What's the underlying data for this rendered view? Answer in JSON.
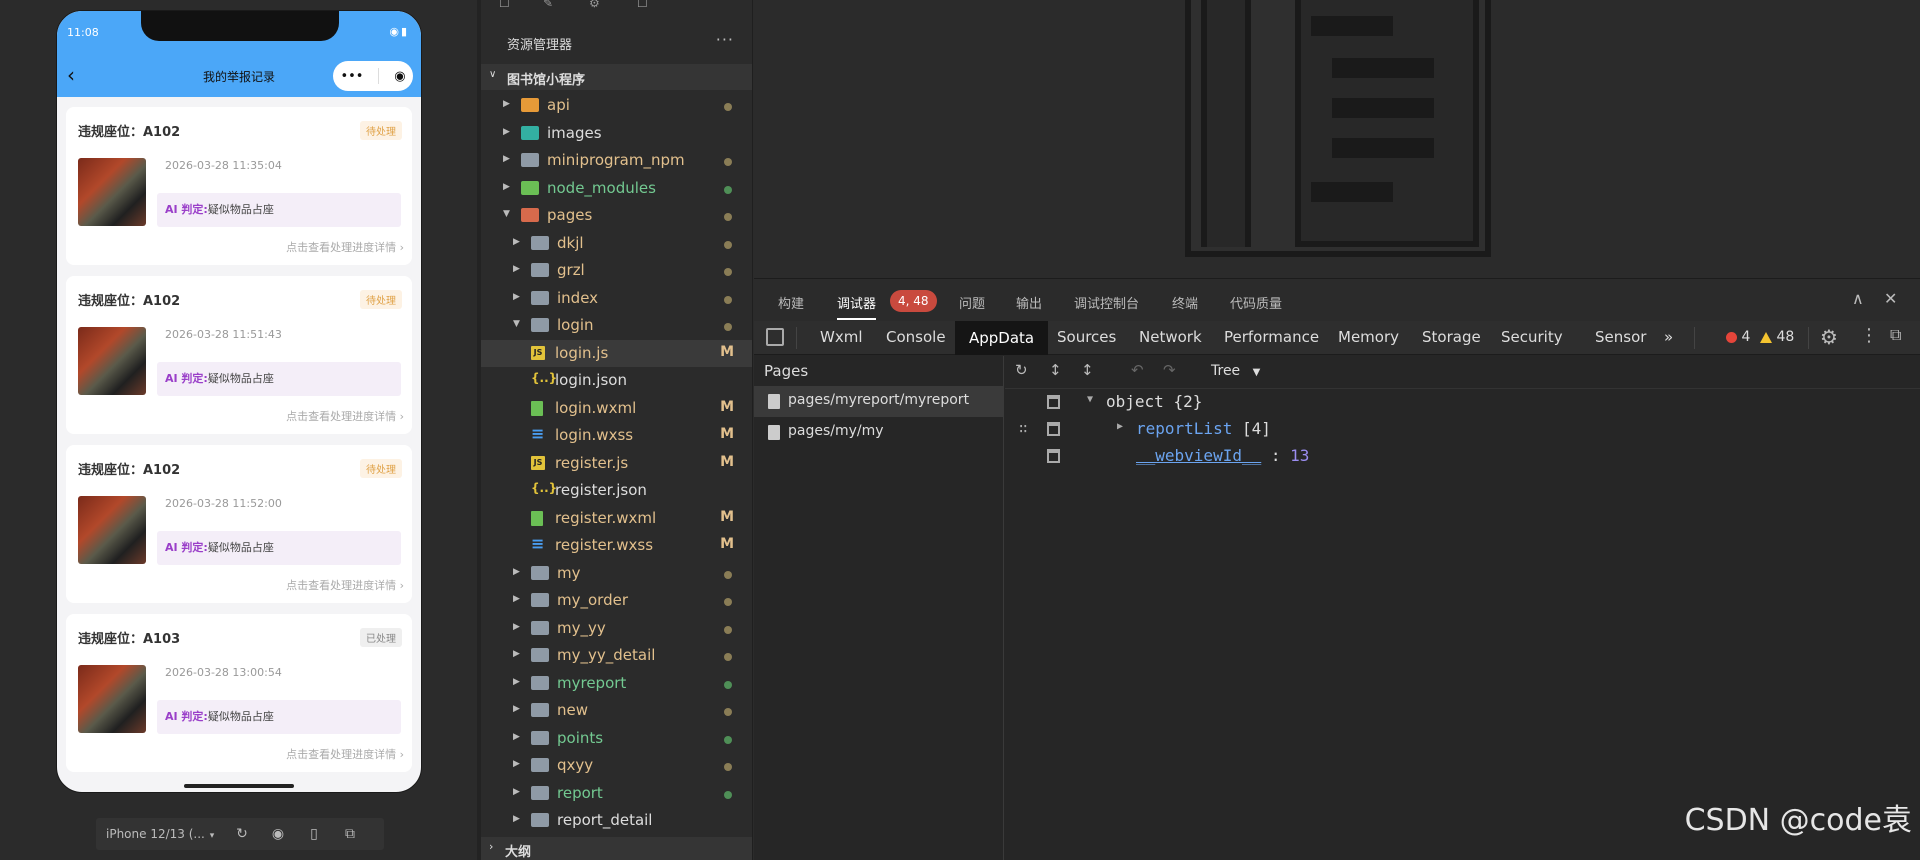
{
  "simulator": {
    "status_time": "11:08",
    "nav_title": "我的举报记录",
    "nav_back_icon": "chevron-left-icon",
    "capsule_more": "•••",
    "capsule_close": "◉",
    "cards": [
      {
        "title": "违规座位：A102",
        "status": "待处理",
        "status_type": "pending",
        "time": "2026-03-28 11:35:04",
        "ai_label": "AI 判定:",
        "ai_text": "疑似物品占座",
        "link": "点击查看处理进度详情 ›"
      },
      {
        "title": "违规座位：A102",
        "status": "待处理",
        "status_type": "pending",
        "time": "2026-03-28 11:51:43",
        "ai_label": "AI 判定:",
        "ai_text": "疑似物品占座",
        "link": "点击查看处理进度详情 ›"
      },
      {
        "title": "违规座位：A102",
        "status": "待处理",
        "status_type": "pending",
        "time": "2026-03-28 11:52:00",
        "ai_label": "AI 判定:",
        "ai_text": "疑似物品占座",
        "link": "点击查看处理进度详情 ›"
      },
      {
        "title": "违规座位：A103",
        "status": "已处理",
        "status_type": "done",
        "time": "2026-03-28 13:00:54",
        "ai_label": "AI 判定:",
        "ai_text": "疑似物品占座",
        "link": "点击查看处理进度详情 ›"
      }
    ],
    "device": "iPhone 12/13 (...",
    "colors": {
      "nav": "#4ba7f8",
      "pending": "#e0a247",
      "ai_label": "#9a3fc9"
    }
  },
  "explorer": {
    "title": "资源管理器",
    "more": "···",
    "project": "图书馆小程序",
    "outline": "大纲",
    "items": [
      {
        "name": "api",
        "depth": 0,
        "type": "folder",
        "color": "orange",
        "expanded": false,
        "status": "dot",
        "name_color": "#e2c08d"
      },
      {
        "name": "images",
        "depth": 0,
        "type": "folder",
        "color": "teal",
        "expanded": false,
        "status": "none",
        "name_color": "#dddddd"
      },
      {
        "name": "miniprogram_npm",
        "depth": 0,
        "type": "folder",
        "color": "gray",
        "expanded": false,
        "status": "dot",
        "name_color": "#e2c08d"
      },
      {
        "name": "node_modules",
        "depth": 0,
        "type": "folder",
        "color": "green",
        "expanded": false,
        "status": "dot-green",
        "name_color": "#73c991"
      },
      {
        "name": "pages",
        "depth": 0,
        "type": "folder",
        "color": "red",
        "expanded": true,
        "status": "dot",
        "name_color": "#e2c08d"
      },
      {
        "name": "dkjl",
        "depth": 1,
        "type": "folder",
        "color": "gray",
        "expanded": false,
        "status": "dot",
        "name_color": "#e2c08d"
      },
      {
        "name": "grzl",
        "depth": 1,
        "type": "folder",
        "color": "gray",
        "expanded": false,
        "status": "dot",
        "name_color": "#e2c08d"
      },
      {
        "name": "index",
        "depth": 1,
        "type": "folder",
        "color": "gray",
        "expanded": false,
        "status": "dot",
        "name_color": "#e2c08d"
      },
      {
        "name": "login",
        "depth": 1,
        "type": "folder",
        "color": "open",
        "expanded": true,
        "status": "dot",
        "name_color": "#e2c08d"
      },
      {
        "name": "login.js",
        "depth": 2,
        "type": "js",
        "status": "M",
        "name_color": "#e2c08d",
        "selected": true
      },
      {
        "name": "login.json",
        "depth": 2,
        "type": "json",
        "status": "none",
        "name_color": "#dddddd"
      },
      {
        "name": "login.wxml",
        "depth": 2,
        "type": "wxml",
        "status": "M",
        "name_color": "#e2c08d"
      },
      {
        "name": "login.wxss",
        "depth": 2,
        "type": "wxss",
        "status": "M",
        "name_color": "#e2c08d"
      },
      {
        "name": "register.js",
        "depth": 2,
        "type": "js",
        "status": "M",
        "name_color": "#e2c08d"
      },
      {
        "name": "register.json",
        "depth": 2,
        "type": "json",
        "status": "none",
        "name_color": "#dddddd"
      },
      {
        "name": "register.wxml",
        "depth": 2,
        "type": "wxml",
        "status": "M",
        "name_color": "#e2c08d"
      },
      {
        "name": "register.wxss",
        "depth": 2,
        "type": "wxss",
        "status": "M",
        "name_color": "#e2c08d"
      },
      {
        "name": "my",
        "depth": 1,
        "type": "folder",
        "color": "gray",
        "expanded": false,
        "status": "dot",
        "name_color": "#e2c08d"
      },
      {
        "name": "my_order",
        "depth": 1,
        "type": "folder",
        "color": "gray",
        "expanded": false,
        "status": "dot",
        "name_color": "#e2c08d"
      },
      {
        "name": "my_yy",
        "depth": 1,
        "type": "folder",
        "color": "gray",
        "expanded": false,
        "status": "dot",
        "name_color": "#e2c08d"
      },
      {
        "name": "my_yy_detail",
        "depth": 1,
        "type": "folder",
        "color": "gray",
        "expanded": false,
        "status": "dot",
        "name_color": "#e2c08d"
      },
      {
        "name": "myreport",
        "depth": 1,
        "type": "folder",
        "color": "gray",
        "expanded": false,
        "status": "dot-green",
        "name_color": "#73c991"
      },
      {
        "name": "new",
        "depth": 1,
        "type": "folder",
        "color": "gray",
        "expanded": false,
        "status": "dot",
        "name_color": "#e2c08d"
      },
      {
        "name": "points",
        "depth": 1,
        "type": "folder",
        "color": "gray",
        "expanded": false,
        "status": "dot-green",
        "name_color": "#73c991"
      },
      {
        "name": "qxyy",
        "depth": 1,
        "type": "folder",
        "color": "gray",
        "expanded": false,
        "status": "dot",
        "name_color": "#e2c08d"
      },
      {
        "name": "report",
        "depth": 1,
        "type": "folder",
        "color": "gray",
        "expanded": false,
        "status": "dot-green",
        "name_color": "#73c991"
      },
      {
        "name": "report_detail",
        "depth": 1,
        "type": "folder",
        "color": "gray",
        "expanded": false,
        "status": "none",
        "name_color": "#dddddd"
      }
    ]
  },
  "debugger": {
    "top_tabs": [
      "构建",
      "调试器",
      "问题",
      "输出",
      "调试控制台",
      "终端",
      "代码质量"
    ],
    "active_top_tab": "调试器",
    "count_badge": "4, 48",
    "devtools_tabs": [
      "Wxml",
      "Console",
      "AppData",
      "Sources",
      "Network",
      "Performance",
      "Memory",
      "Storage",
      "Security",
      "Sensor"
    ],
    "active_devtools_tab": "AppData",
    "more_tabs": "»",
    "error_count": "4",
    "warning_count": "48",
    "pages_header": "Pages",
    "pages": [
      "pages/myreport/myreport",
      "pages/my/my"
    ],
    "active_page": "pages/myreport/myreport",
    "view_mode": "Tree",
    "tree": {
      "root_label": "object",
      "root_count": "{2}",
      "report_key": "reportList",
      "report_count": "[4]",
      "webview_key": "__webviewId__",
      "webview_sep": ":",
      "webview_value": "13"
    }
  },
  "watermark": "CSDN @code袁"
}
